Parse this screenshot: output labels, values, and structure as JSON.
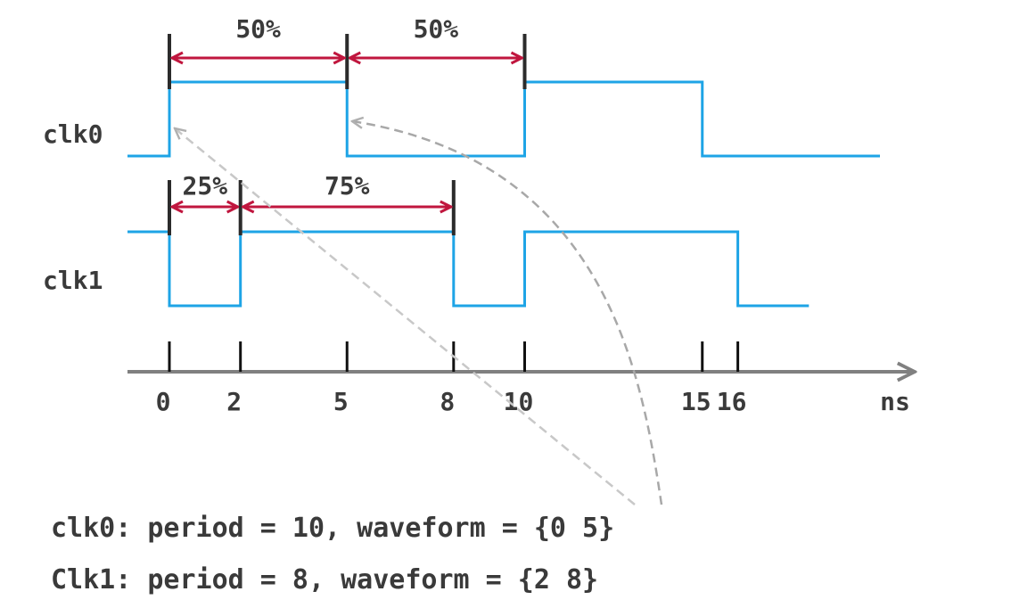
{
  "signals": [
    {
      "name": "clk0",
      "initial_level": 0,
      "edges": [
        0,
        5,
        10,
        15
      ],
      "end": 20,
      "duty_marks": [
        0,
        5,
        10
      ],
      "duty_labels": [
        "50%",
        "50%"
      ]
    },
    {
      "name": "clk1",
      "initial_level": 1,
      "edges": [
        0,
        2,
        8,
        10,
        16
      ],
      "end": 18,
      "duty_marks": [
        0,
        2,
        8
      ],
      "duty_labels": [
        "25%",
        "75%"
      ]
    }
  ],
  "axis": {
    "ticks": [
      0,
      2,
      5,
      8,
      10,
      15,
      16
    ],
    "tick_labels": [
      "0",
      "2",
      "5",
      "8",
      "10",
      "15",
      "16"
    ],
    "unit": "ns"
  },
  "constraints": [
    "clk0: period = 10, waveform = {0 5}",
    "Clk1: period = 8, waveform = {2 8}"
  ],
  "colors": {
    "wave": "#1ea4e6",
    "duty_arrow": "#c0163e",
    "marker": "#2b2b2b",
    "axis": "#808080",
    "pointer": "#b0b0b0",
    "text": "#3a3a3a"
  }
}
